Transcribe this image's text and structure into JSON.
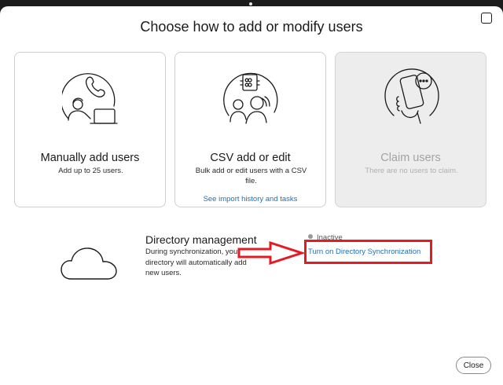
{
  "dialog": {
    "title": "Choose how to add or modify users",
    "close_label": "Close"
  },
  "cards": [
    {
      "title": "Manually add users",
      "description": "Add up to 25 users.",
      "icon": "person-phone-laptop-icon",
      "enabled": true
    },
    {
      "title": "CSV add or edit",
      "description": "Bulk add or edit users with a CSV file.",
      "link": "See import history and tasks",
      "icon": "csv-team-icon",
      "enabled": true
    },
    {
      "title": "Claim users",
      "description": "There are no users to claim.",
      "icon": "hand-phone-icon",
      "enabled": false
    }
  ],
  "directory": {
    "title": "Directory management",
    "description": "During synchronization, your directory will automatically add new users.",
    "status": "Inactive",
    "sync_link": "Turn on Directory Synchronization",
    "icon": "cloud-icon"
  },
  "annotation": {
    "color": "#e41b23"
  },
  "colors": {
    "link": "#1f6fb8"
  }
}
